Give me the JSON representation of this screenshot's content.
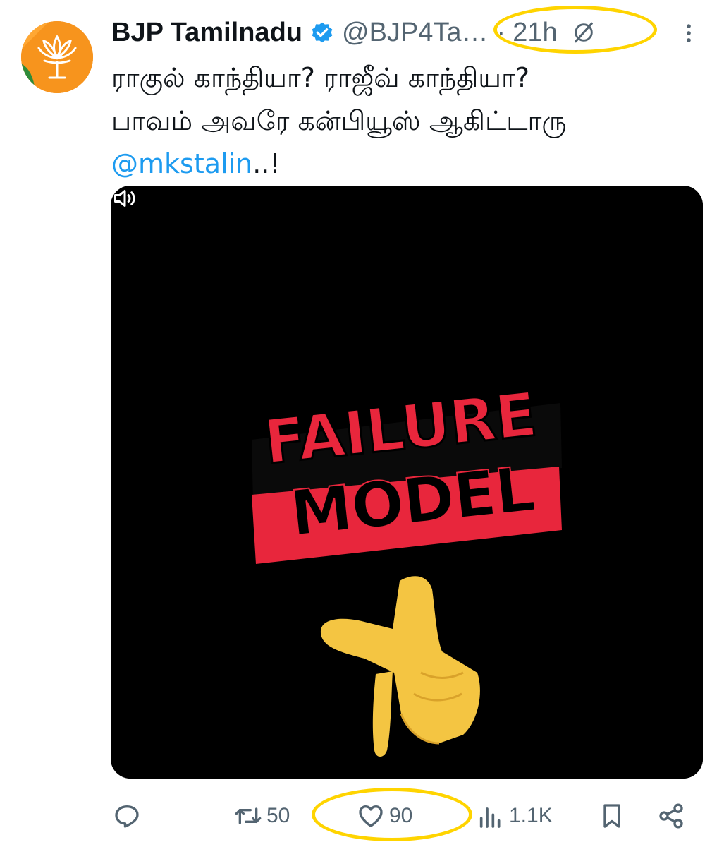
{
  "tweet": {
    "author": {
      "display_name": "BJP Tamilnadu",
      "handle": "@BJP4Ta…",
      "verified": true,
      "avatar_icon": "lotus-logo-icon"
    },
    "separator": "·",
    "timestamp": "21h",
    "text_lines": [
      "ராகுல் காந்தியா? ராஜீவ் காந்தியா?",
      "பாவம் அவரே கன்பியூஸ் ஆகிட்டாரு"
    ],
    "mention": "@mkstalin",
    "mention_suffix": "..!",
    "media": {
      "type": "video",
      "caption_line1": "FAILURE",
      "caption_line2": "MODEL",
      "volume_icon": "volume-icon"
    },
    "actions": {
      "reply_count": "",
      "retweet_count": "50",
      "like_count": "90",
      "views_count": "1.1K"
    }
  },
  "colors": {
    "text": "#0f1419",
    "secondary": "#536471",
    "link": "#1d9bf0",
    "verified": "#1d9bf0",
    "highlight": "#ffd400",
    "avatar_bg": "#f7941d",
    "banner_red": "#e8263c",
    "media_bg": "#000000"
  }
}
